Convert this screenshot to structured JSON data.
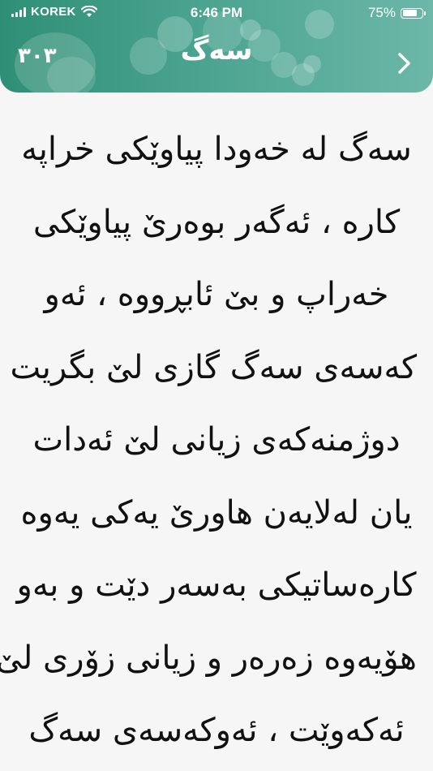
{
  "status_bar": {
    "carrier": "KOREK",
    "time": "6:46 PM",
    "battery_percent": "75%",
    "battery_level": 0.75,
    "signal_bars": 4
  },
  "header": {
    "page_number": "٣٠٣",
    "title": "سەگ",
    "next_icon": "chevron-right-icon"
  },
  "content": {
    "lines": [
      "سەگ لە خەودا پیاوێکی خراپە",
      "کارە ، ئەگەر بوەرێ پیاوێکی",
      "خەراپ و بێ ئابڕووە ، ئەو",
      "کەسەی سەگ گازی لێ بگریت",
      "دوژمنەکەی زیانی لێ ئەدات",
      "یان لەلایەن هاورێ یەکی یەوە",
      "کارەساتیکی بەسەر دێت و بەو",
      "هۆیەوە زەرەر و زیانی زۆری لێ",
      "ئەکەوێت ، ئەوکەسەی سەگ"
    ]
  },
  "colors": {
    "header_start": "#2f8f76",
    "header_end": "#6cb7a8",
    "background": "#f6f6f6",
    "text": "#111111"
  }
}
